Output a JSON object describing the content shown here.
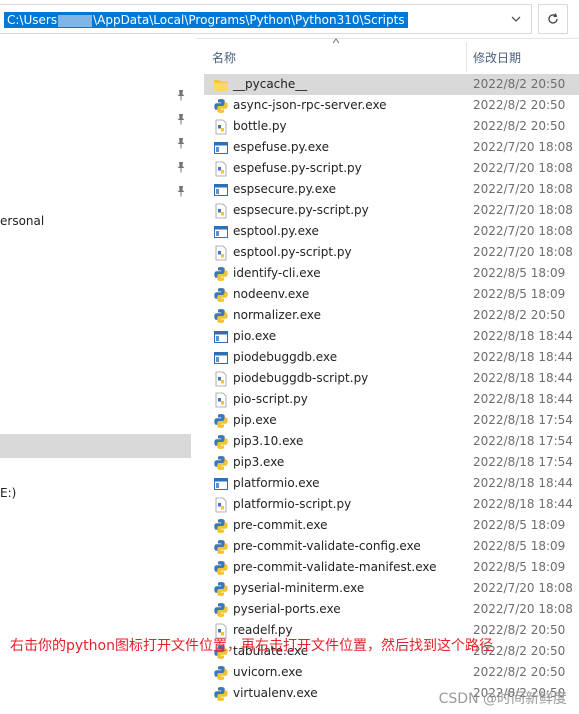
{
  "address_bar": {
    "path_prefix": "C:\\Users",
    "path_suffix": "\\AppData\\Local\\Programs\\Python\\Python310\\Scripts",
    "dropdown_icon": "chevron-down-icon",
    "refresh_icon": "refresh-icon"
  },
  "nav": {
    "item_personal": "ersonal",
    "item_drive": "E:)"
  },
  "columns": {
    "name": "名称",
    "date_modified": "修改日期"
  },
  "files": [
    {
      "name": "__pycache__",
      "date": "2022/8/2 20:50",
      "icon": "folder-icon",
      "selected": true
    },
    {
      "name": "async-json-rpc-server.exe",
      "date": "2022/8/2 20:50",
      "icon": "python-exe-icon"
    },
    {
      "name": "bottle.py",
      "date": "2022/8/2 20:50",
      "icon": "python-file-icon"
    },
    {
      "name": "espefuse.py.exe",
      "date": "2022/7/20 18:08",
      "icon": "exe-window-icon"
    },
    {
      "name": "espefuse.py-script.py",
      "date": "2022/7/20 18:08",
      "icon": "python-file-icon"
    },
    {
      "name": "espsecure.py.exe",
      "date": "2022/7/20 18:08",
      "icon": "exe-window-icon"
    },
    {
      "name": "espsecure.py-script.py",
      "date": "2022/7/20 18:08",
      "icon": "python-file-icon"
    },
    {
      "name": "esptool.py.exe",
      "date": "2022/7/20 18:08",
      "icon": "exe-window-icon"
    },
    {
      "name": "esptool.py-script.py",
      "date": "2022/7/20 18:08",
      "icon": "python-file-icon"
    },
    {
      "name": "identify-cli.exe",
      "date": "2022/8/5 18:09",
      "icon": "python-exe-icon"
    },
    {
      "name": "nodeenv.exe",
      "date": "2022/8/5 18:09",
      "icon": "python-exe-icon"
    },
    {
      "name": "normalizer.exe",
      "date": "2022/8/2 20:50",
      "icon": "python-exe-icon"
    },
    {
      "name": "pio.exe",
      "date": "2022/8/18 18:44",
      "icon": "exe-window-icon"
    },
    {
      "name": "piodebuggdb.exe",
      "date": "2022/8/18 18:44",
      "icon": "exe-window-icon"
    },
    {
      "name": "piodebuggdb-script.py",
      "date": "2022/8/18 18:44",
      "icon": "python-file-icon"
    },
    {
      "name": "pio-script.py",
      "date": "2022/8/18 18:44",
      "icon": "python-file-icon"
    },
    {
      "name": "pip.exe",
      "date": "2022/8/18 17:54",
      "icon": "python-exe-icon"
    },
    {
      "name": "pip3.10.exe",
      "date": "2022/8/18 17:54",
      "icon": "python-exe-icon"
    },
    {
      "name": "pip3.exe",
      "date": "2022/8/18 17:54",
      "icon": "python-exe-icon"
    },
    {
      "name": "platformio.exe",
      "date": "2022/8/18 18:44",
      "icon": "exe-window-icon"
    },
    {
      "name": "platformio-script.py",
      "date": "2022/8/18 18:44",
      "icon": "python-file-icon"
    },
    {
      "name": "pre-commit.exe",
      "date": "2022/8/5 18:09",
      "icon": "python-exe-icon"
    },
    {
      "name": "pre-commit-validate-config.exe",
      "date": "2022/8/5 18:09",
      "icon": "python-exe-icon"
    },
    {
      "name": "pre-commit-validate-manifest.exe",
      "date": "2022/8/5 18:09",
      "icon": "python-exe-icon"
    },
    {
      "name": "pyserial-miniterm.exe",
      "date": "2022/7/20 18:08",
      "icon": "python-exe-icon"
    },
    {
      "name": "pyserial-ports.exe",
      "date": "2022/7/20 18:08",
      "icon": "python-exe-icon"
    },
    {
      "name": "readelf.py",
      "date": "2022/8/2 20:50",
      "icon": "python-file-icon"
    },
    {
      "name": "tabulate.exe",
      "date": "2022/8/2 20:50",
      "icon": "python-exe-icon"
    },
    {
      "name": "uvicorn.exe",
      "date": "2022/8/2 20:50",
      "icon": "python-exe-icon"
    },
    {
      "name": "virtualenv.exe",
      "date": "2022/8/2 20:50",
      "icon": "python-exe-icon"
    }
  ],
  "annotation": "右击你的python图标打开文件位置，再右击打开文件位置，然后找到这个路径",
  "watermark": "CSDN @时间新鲜度",
  "colors": {
    "selection": "#d9d9d9",
    "address_highlight": "#0078d7",
    "annotation": "#e8202a",
    "header_text": "#4c607a"
  }
}
